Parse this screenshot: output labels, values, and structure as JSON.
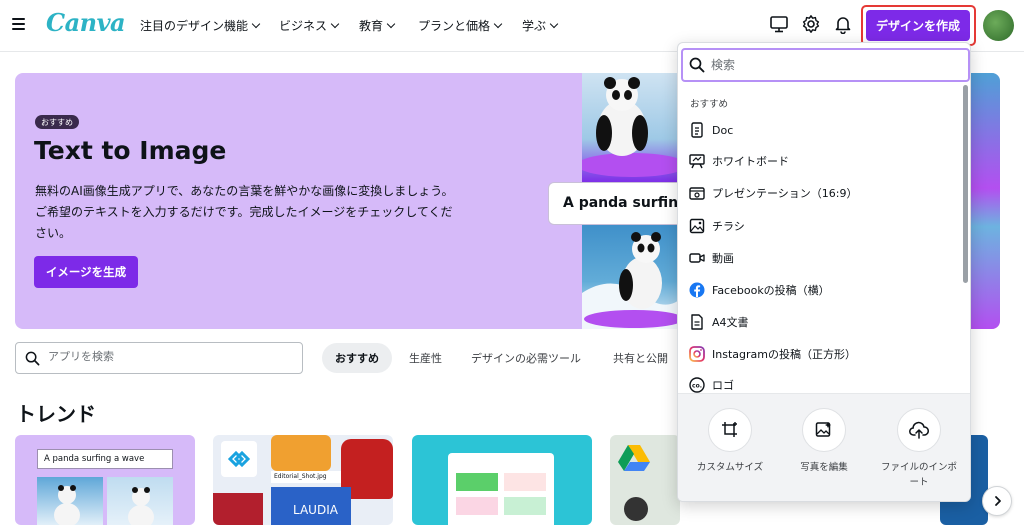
{
  "header": {
    "logo": "Canva",
    "nav": [
      "注目のデザイン機能",
      "ビジネス",
      "教育",
      "プランと価格",
      "学ぶ"
    ],
    "create_button": "デザインを作成"
  },
  "hero": {
    "badge": "おすすめ",
    "title": "Text to Image",
    "description": "無料のAI画像生成アプリで、あなたの言葉を鮮やかな画像に変換しましょう。ご希望のテキストを入力するだけです。完成したイメージをチェックしてください。",
    "button": "イメージを生成",
    "prompt_example": "A panda surfing"
  },
  "app_search": {
    "placeholder": "アプリを検索"
  },
  "chips": [
    "おすすめ",
    "生産性",
    "デザインの必需ツール",
    "共有と公開"
  ],
  "trend": {
    "title": "トレンド",
    "card1_prompt": "A panda surfing a wave",
    "card2_file": "Editorial_Shot.jpg",
    "card2_logo": "LAUDIA"
  },
  "dropdown": {
    "search_placeholder": "検索",
    "section_label": "おすすめ",
    "items": [
      {
        "label": "Doc",
        "icon": "doc-icon"
      },
      {
        "label": "ホワイトボード",
        "icon": "whiteboard-icon"
      },
      {
        "label": "プレゼンテーション（16:9）",
        "icon": "presentation-icon"
      },
      {
        "label": "チラシ",
        "icon": "image-icon"
      },
      {
        "label": "動画",
        "icon": "video-icon"
      },
      {
        "label": "Facebookの投稿（横）",
        "icon": "facebook-icon"
      },
      {
        "label": "A4文書",
        "icon": "document-icon"
      },
      {
        "label": "Instagramの投稿（正方形）",
        "icon": "instagram-icon"
      },
      {
        "label": "ロゴ",
        "icon": "logo-icon"
      }
    ],
    "actions": [
      "カスタムサイズ",
      "写真を編集",
      "ファイルのインポート"
    ]
  },
  "colors": {
    "accent": "#7d2ae8",
    "brand": "#2db3c5",
    "hero_bg": "#d6baf9",
    "highlight": "#e53935"
  }
}
